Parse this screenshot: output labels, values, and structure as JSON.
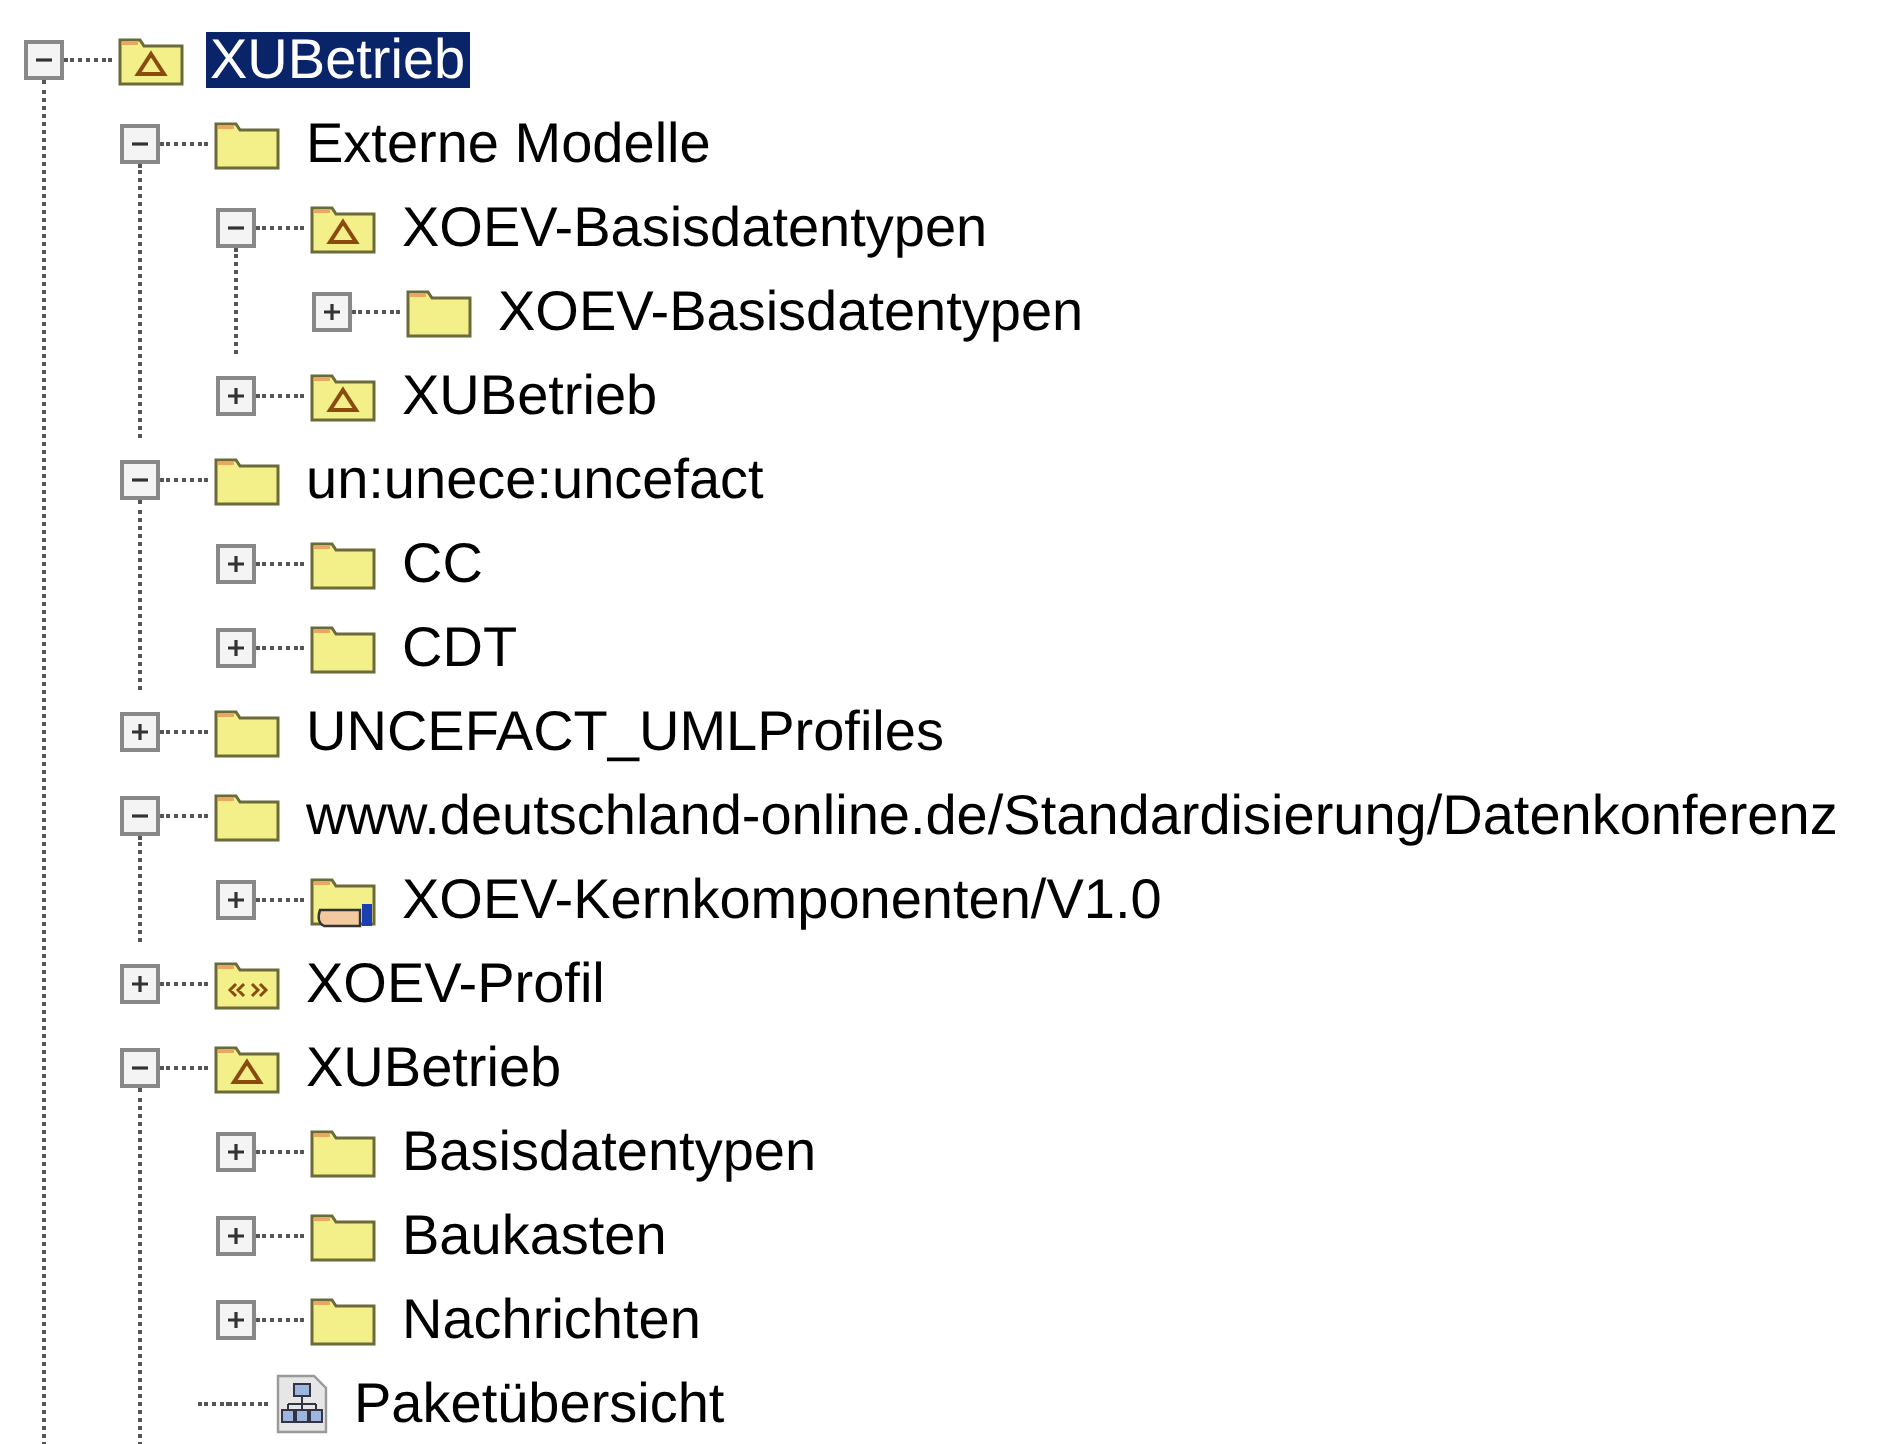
{
  "tree": [
    {
      "label": "XUBetrieb",
      "kind": "model",
      "expanded": true,
      "selected": true,
      "children": [
        {
          "label": "Externe Modelle",
          "kind": "package",
          "expanded": true,
          "selected": false,
          "children": [
            {
              "label": "XOEV-Basisdatentypen",
              "kind": "model",
              "expanded": true,
              "selected": false,
              "children": [
                {
                  "label": "XOEV-Basisdatentypen",
                  "kind": "package",
                  "expanded": false,
                  "selected": false
                }
              ]
            },
            {
              "label": "XUBetrieb",
              "kind": "model",
              "expanded": false,
              "selected": false
            }
          ]
        },
        {
          "label": "un:unece:uncefact",
          "kind": "package",
          "expanded": true,
          "selected": false,
          "children": [
            {
              "label": "CC",
              "kind": "package",
              "expanded": false,
              "selected": false
            },
            {
              "label": "CDT",
              "kind": "package",
              "expanded": false,
              "selected": false
            }
          ]
        },
        {
          "label": "UNCEFACT_UMLProfiles",
          "kind": "package",
          "expanded": false,
          "selected": false
        },
        {
          "label": "www.deutschland-online.de/Standardisierung/Datenkonferenz",
          "kind": "package",
          "expanded": true,
          "selected": false,
          "children": [
            {
              "label": "XOEV-Kernkomponenten/V1.0",
              "kind": "shared",
              "expanded": false,
              "selected": false
            }
          ]
        },
        {
          "label": "XOEV-Profil",
          "kind": "profile",
          "expanded": false,
          "selected": false
        },
        {
          "label": "XUBetrieb",
          "kind": "model",
          "expanded": true,
          "selected": false,
          "children": [
            {
              "label": "Basisdatentypen",
              "kind": "package",
              "expanded": false,
              "selected": false
            },
            {
              "label": "Baukasten",
              "kind": "package",
              "expanded": false,
              "selected": false
            },
            {
              "label": "Nachrichten",
              "kind": "package",
              "expanded": false,
              "selected": false
            },
            {
              "label": "Paketübersicht",
              "kind": "diagram",
              "selected": false
            }
          ]
        }
      ]
    }
  ]
}
